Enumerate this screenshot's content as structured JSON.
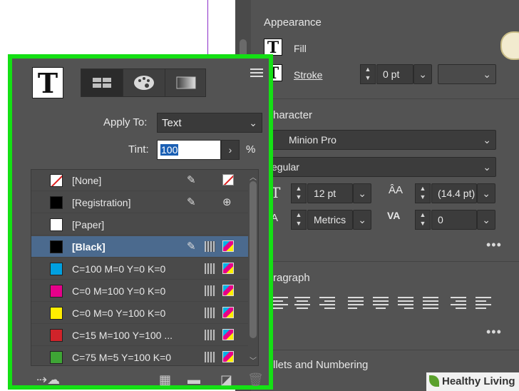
{
  "appearance": {
    "title": "Appearance",
    "fill_label": "Fill",
    "stroke_label": "Stroke ",
    "stroke_weight": "0 pt"
  },
  "character": {
    "title": "haracter",
    "font_family": "Minion Pro",
    "font_style": "egular",
    "font_size": "12 pt",
    "leading": "(14.4 pt)",
    "kerning": "Metrics",
    "tracking": "0"
  },
  "paragraph": {
    "title": "ragraph"
  },
  "bullets": {
    "title": "llets and Numbering"
  },
  "swatches": {
    "apply_to_label": "Apply To:",
    "apply_to_value": "Text",
    "tint_label": "Tint:",
    "tint_value": "100",
    "tint_unit": "%",
    "items": [
      {
        "name": "[None]",
        "color": "#ffffff",
        "icons": [
          "pen-cross-icon",
          "none-icon"
        ]
      },
      {
        "name": "[Registration]",
        "color": "#000000",
        "icons": [
          "pen-cross-icon",
          "registration-icon"
        ]
      },
      {
        "name": "[Paper]",
        "color": "#ffffff",
        "icons": []
      },
      {
        "name": "[Black]",
        "color": "#000000",
        "icons": [
          "pen-cross-icon",
          "spot-grid-icon",
          "cmyk-icon"
        ],
        "selected": true
      },
      {
        "name": "C=100 M=0 Y=0 K=0",
        "color": "#00a0e0",
        "icons": [
          "spot-grid-icon",
          "cmyk-icon"
        ]
      },
      {
        "name": "C=0 M=100 Y=0 K=0",
        "color": "#e6008a",
        "icons": [
          "spot-grid-icon",
          "cmyk-icon"
        ]
      },
      {
        "name": "C=0 M=0 Y=100 K=0",
        "color": "#ffee00",
        "icons": [
          "spot-grid-icon",
          "cmyk-icon"
        ]
      },
      {
        "name": "C=15 M=100 Y=100 ...",
        "color": "#d0232a",
        "icons": [
          "spot-grid-icon",
          "cmyk-icon"
        ]
      },
      {
        "name": "C=75 M=5 Y=100 K=0",
        "color": "#3ea535",
        "icons": [
          "spot-grid-icon",
          "cmyk-icon"
        ]
      }
    ]
  },
  "watermark": {
    "text": "Healthy Living"
  },
  "colors": {
    "highlight_border": "#14e014",
    "selected_row": "#4b6a8e"
  }
}
